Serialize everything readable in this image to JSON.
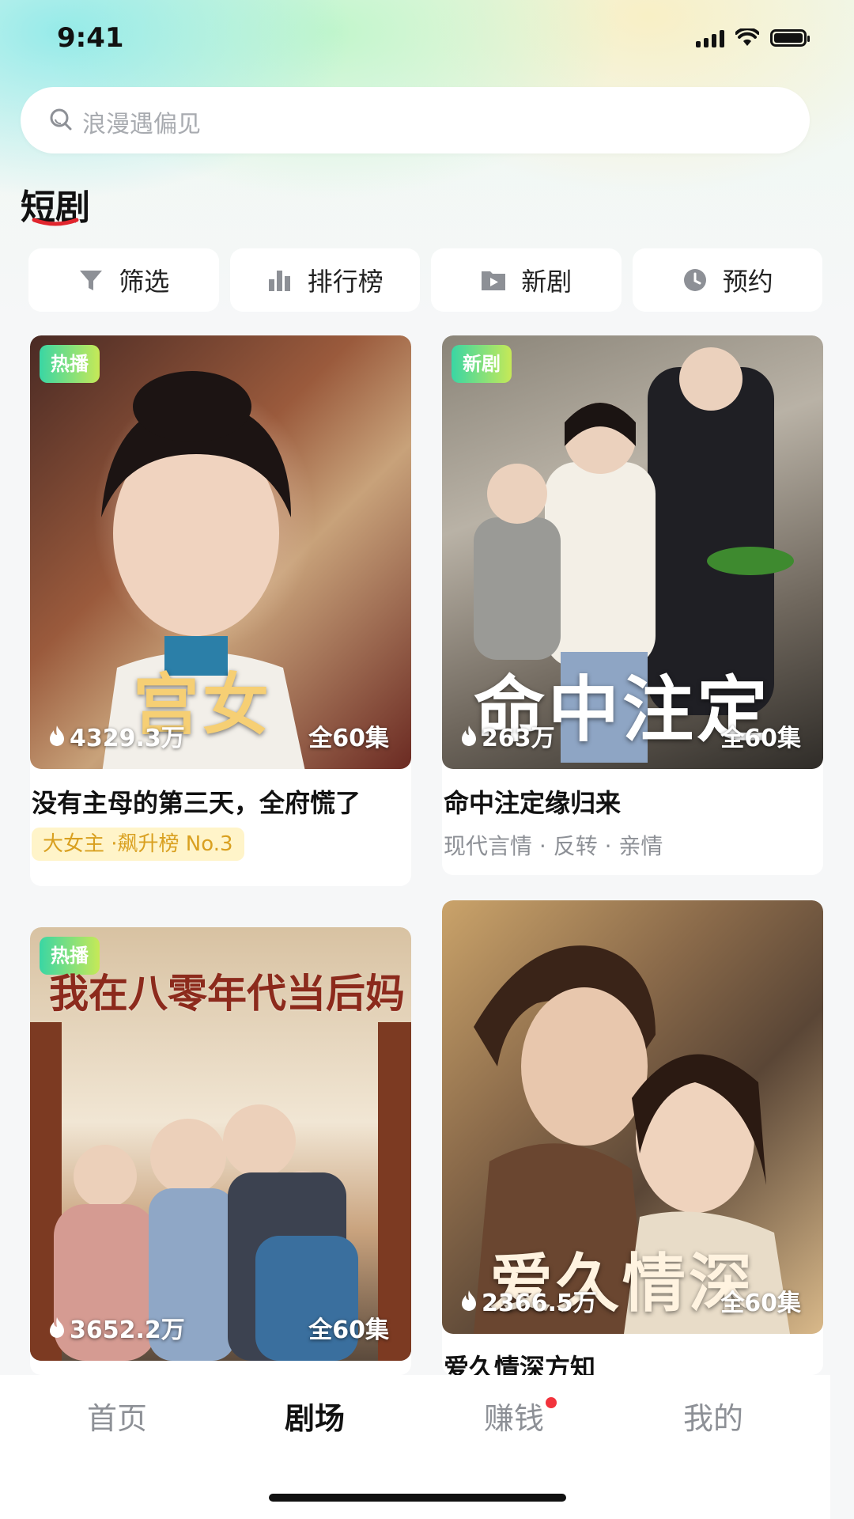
{
  "status": {
    "time": "9:41"
  },
  "search": {
    "placeholder": "浪漫遇偏见"
  },
  "section": {
    "title": "短剧"
  },
  "chips": [
    {
      "label": "筛选",
      "icon": "filter-icon"
    },
    {
      "label": "排行榜",
      "icon": "bar-chart-icon"
    },
    {
      "label": "新剧",
      "icon": "play-folder-icon"
    },
    {
      "label": "预约",
      "icon": "clock-icon"
    }
  ],
  "cards": [
    {
      "badge": "热播",
      "hot": "4329.3万",
      "episodes": "全60集",
      "title": "没有主母的第三天，全府慌了",
      "tag": "大女主 ·飙升榜 No.3",
      "poster_text": "宫女",
      "poster_colors": [
        "#7a2b25",
        "#c8a27a",
        "#3e2a24"
      ]
    },
    {
      "badge": "新剧",
      "hot": "263万",
      "episodes": "全60集",
      "title": "命中注定缘归来",
      "tags": "现代言情 · 反转 · 亲情",
      "poster_text": "命中注定",
      "poster_colors": [
        "#6f6a62",
        "#b9b2a6",
        "#3a3834"
      ]
    },
    {
      "badge": "热播",
      "hot": "3652.2万",
      "episodes": "全60集",
      "poster_text": "我在八零年代当后妈",
      "poster_colors": [
        "#c9a37e",
        "#e9d8c0",
        "#5b4a3c"
      ]
    },
    {
      "hot": "2366.5万",
      "episodes": "全60集",
      "title": "爱久情深方知",
      "poster_text": "爱久情深",
      "poster_colors": [
        "#5a4636",
        "#caa36a",
        "#2e2520"
      ]
    }
  ],
  "nav": {
    "items": [
      "首页",
      "剧场",
      "赚钱",
      "我的"
    ],
    "active": "剧场"
  }
}
